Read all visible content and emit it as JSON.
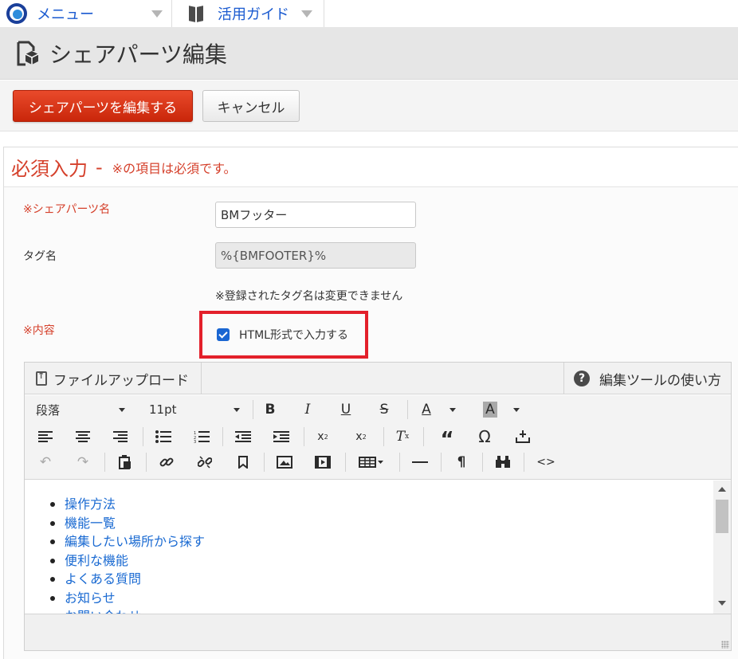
{
  "topbar": {
    "menu_label": "メニュー",
    "guide_label": "活用ガイド"
  },
  "page": {
    "title": "シェアパーツ編集"
  },
  "actions": {
    "submit_label": "シェアパーツを編集する",
    "cancel_label": "キャンセル",
    "submit_color": "#d7321a"
  },
  "section": {
    "title": "必須入力",
    "dash": "-",
    "note": "※の項目は必須です。",
    "accent_color": "#d5402b"
  },
  "form": {
    "name_label": "※シェアパーツ名",
    "name_value": "BMフッター",
    "tag_label": "タグ名",
    "tag_value": "%{BMFOOTER}%",
    "tag_helper": "※登録されたタグ名は変更できません",
    "content_label": "※内容",
    "html_checkbox_label": "HTML形式で入力する",
    "html_checkbox_checked": true
  },
  "editor": {
    "upload_label": "ファイルアップロード",
    "help_label": "編集ツールの使い方",
    "paragraph_select": "段落",
    "fontsize_select": "11pt",
    "content_items": [
      "操作方法",
      "機能一覧",
      "編集したい場所から探す",
      "便利な機能",
      "よくある質問",
      "お知らせ",
      "お問い合わせ"
    ]
  }
}
